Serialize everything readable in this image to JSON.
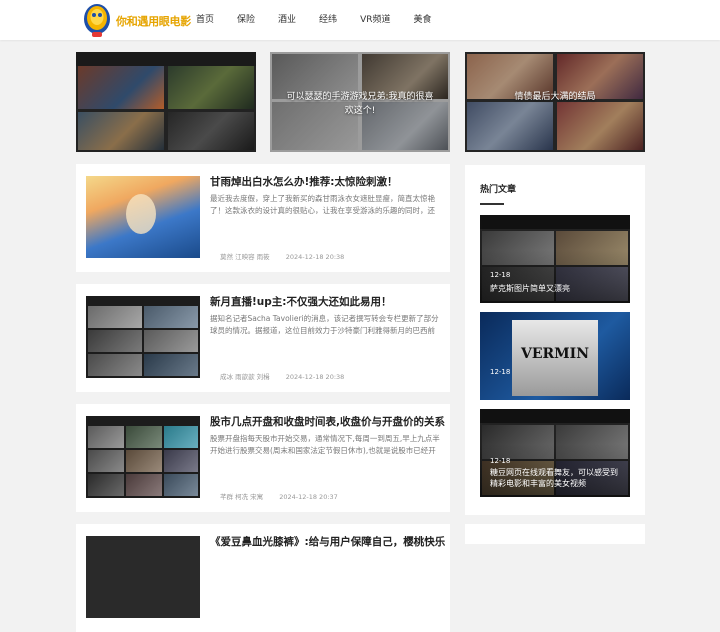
{
  "header": {
    "logo_text": "你和遇用眼电影",
    "nav": [
      "首页",
      "保险",
      "酒业",
      "经纬",
      "VR频道",
      "美食"
    ]
  },
  "banner": [
    {
      "caption": ""
    },
    {
      "caption": "可以瑟瑟的手游游戏兄弟:我真的很喜欢这个!"
    },
    {
      "caption": "情债最后大满的结局"
    }
  ],
  "articles": [
    {
      "title": "甘雨焯出白水怎么办!推荐:太惊险刺激！",
      "excerpt": "最近我去度假，穿上了我新买的森甘雨泳衣女遮肚显瘦，简直太惊艳了！这款泳衣的设计真的很贴心，让我在享受游泳的乐趣的同时，还能...",
      "tags": "莫然 江映容 雨筱",
      "date": "2024-12-18 20:38"
    },
    {
      "title": "新月直播!up主:不仅强大还如此易用！",
      "excerpt": "据知名记者Sacha Tavolieri的消息，该记者撰写转会专栏更新了部分球员的情况。据报道，这位目前效力于沙特豪门利雅得新月的巴西前锋已经向...",
      "tags": "成冰 雨歆歆 刘楫",
      "date": "2024-12-18 20:38"
    },
    {
      "title": "股市几点开盘和收盘时间表,收盘价与开盘价的关系",
      "excerpt": "股票开盘指每天股市开始交易，通常情况下,每周一到周五,早上九点半开始进行股票交易(周末和国家法定节假日休市),也就是说股市已经开盘了,或...",
      "tags": "芊群 柯冼 宋寓",
      "date": "2024-12-18 20:37"
    },
    {
      "title": "《爱豆鼻血光膝裤》:给与用户保障自己，樱桃快乐",
      "excerpt": "",
      "tags": "",
      "date": ""
    }
  ],
  "sidebar": {
    "title": "热门文章",
    "items": [
      {
        "date": "12-18",
        "caption": "萨克斯图片简单又漂亮"
      },
      {
        "date": "12-18",
        "caption": "",
        "poster_title": "VERMIN"
      },
      {
        "date": "12-18",
        "caption": "糖豆网页在线观看舞友，可以感受到精彩电影和丰富的美女视频"
      }
    ]
  }
}
